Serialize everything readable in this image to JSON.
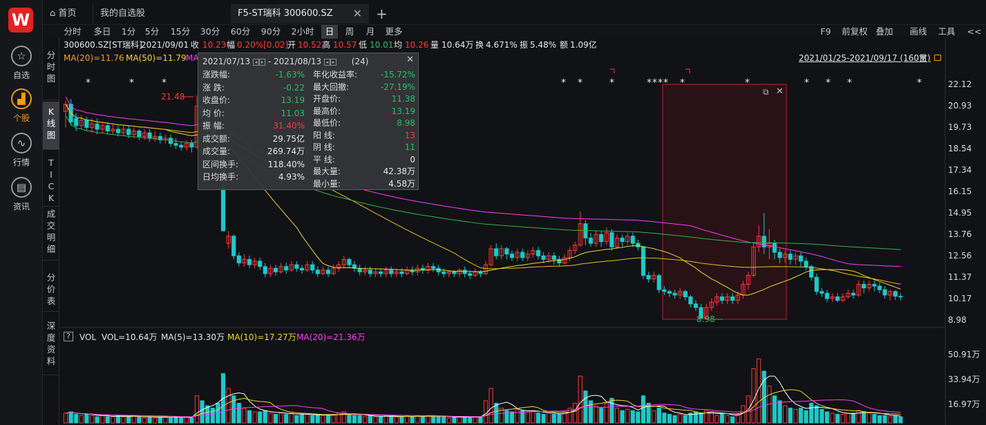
{
  "app": {
    "logo": "W"
  },
  "rail": [
    {
      "label": "自选",
      "icon": "☆",
      "icon_name": "star-icon",
      "active": false
    },
    {
      "label": "个股",
      "icon": "▟",
      "icon_name": "stock-chart-icon",
      "active": true
    },
    {
      "label": "行情",
      "icon": "∿",
      "icon_name": "market-icon",
      "active": false
    },
    {
      "label": "资讯",
      "icon": "▤",
      "icon_name": "news-icon",
      "active": false
    }
  ],
  "tabs": {
    "home": "首页",
    "home_icon": "⌂",
    "watchlist": "我的自选股",
    "current": "F5-ST瑞科 300600.SZ",
    "close": "✕",
    "add": "+"
  },
  "periods": [
    "分时",
    "多日",
    "1分",
    "5分",
    "15分",
    "30分",
    "60分",
    "90分",
    "2小时",
    "日",
    "周",
    "月",
    "更多"
  ],
  "period_selected": "日",
  "tools": [
    "F9",
    "前复权",
    "叠加",
    "画线",
    "工具",
    "<<"
  ],
  "vtabs": [
    {
      "label": "分时图",
      "selected": false
    },
    {
      "label": "K线图",
      "selected": true
    },
    {
      "label": "TICK",
      "selected": false
    },
    {
      "label": "成交明细",
      "selected": false
    },
    {
      "label": "分价表",
      "selected": false
    },
    {
      "label": "深度资料",
      "selected": false
    }
  ],
  "quote": {
    "code": "300600.SZ[ST瑞科]",
    "date": "2021/09/01",
    "close_label": "收",
    "close": "10.23",
    "change_label": "幅",
    "change": "0.20%[0.02]",
    "open_label": "开",
    "open": "10.52",
    "high_label": "高",
    "high": "10.57",
    "low_label": "低",
    "low": "10.01",
    "avg_label": "均",
    "avg": "10.26",
    "vol_label": "量",
    "vol": "10.64万",
    "turnover_label": "换",
    "turnover": "4.671%",
    "amp_label": "振",
    "amp": "5.48%",
    "amount_label": "额",
    "amount": "1.09亿"
  },
  "ma": {
    "ma20": "MA(20)=11.76",
    "ma50": "MA(50)=11.79",
    "ma_cut": "MA"
  },
  "range_label": "2021/01/25-2021/09/17 (160日)",
  "popup": {
    "from": "2021/07/13",
    "to": "- 2021/08/13",
    "count": "(24)",
    "close": "✕",
    "left": [
      {
        "k": "涨跌幅:",
        "v": "-1.63%",
        "c": "green"
      },
      {
        "k": "涨  跌:",
        "v": "-0.22",
        "c": "green"
      },
      {
        "k": "收盘价:",
        "v": "13.19",
        "c": "green"
      },
      {
        "k": "均  价:",
        "v": "11.03",
        "c": "green"
      },
      {
        "k": "振  幅:",
        "v": "31.40%",
        "c": "red"
      },
      {
        "k": "成交额:",
        "v": "29.75亿",
        "c": "white"
      },
      {
        "k": "成交量:",
        "v": "269.74万",
        "c": "white"
      },
      {
        "k": "区间换手:",
        "v": "118.40%",
        "c": "white"
      },
      {
        "k": "日均换手:",
        "v": "4.93%",
        "c": "white"
      }
    ],
    "right": [
      {
        "k": "年化收益率:",
        "v": "-15.72%",
        "c": "green"
      },
      {
        "k": "最大回撤:",
        "v": "-27.19%",
        "c": "green"
      },
      {
        "k": "开盘价:",
        "v": "11.38",
        "c": "green"
      },
      {
        "k": "最高价:",
        "v": "13.19",
        "c": "green"
      },
      {
        "k": "最低价:",
        "v": "8.98",
        "c": "green"
      },
      {
        "k": "阳  线:",
        "v": "13",
        "c": "red"
      },
      {
        "k": "阴  线:",
        "v": "11",
        "c": "green"
      },
      {
        "k": "平  线:",
        "v": "0",
        "c": "white"
      },
      {
        "k": "最大量:",
        "v": "42.38万",
        "c": "white"
      },
      {
        "k": "最小量:",
        "v": "4.58万",
        "c": "white"
      }
    ]
  },
  "annotations": {
    "high_mark": "21.48",
    "low_mark": "8.98",
    "star": "*"
  },
  "price_axis": [
    "22.12",
    "20.93",
    "19.73",
    "18.54",
    "17.34",
    "16.15",
    "14.95",
    "13.76",
    "12.56",
    "11.37",
    "10.17",
    "8.98"
  ],
  "vol_axis": [
    "50.91万",
    "33.94万",
    "16.97万"
  ],
  "vol_legend": {
    "help": "?",
    "name": "VOL",
    "vol": "VOL=10.64万",
    "ma5": "MA(5)=13.30万",
    "ma10": "MA(10)=17.27万",
    "ma20": "MA(20)=21.36万"
  },
  "colors": {
    "up": "#ff3a3a",
    "down": "#1ec8c8",
    "ma5": "#ffffff",
    "ma10": "#f3d63b",
    "ma20": "#ff3dff",
    "ma_long": "#2fb84a",
    "accent": "#f29a1c",
    "logo": "#e02323"
  },
  "chart_data": {
    "type": "candlestick",
    "xlabel": "",
    "ylabel": "",
    "ylim": [
      8.98,
      22.12
    ],
    "note": "candle values approximated from the picture",
    "candles": [
      [
        20.6,
        21.0,
        21.2,
        19.7
      ],
      [
        21.0,
        20.0,
        21.3,
        19.8
      ],
      [
        20.2,
        19.8,
        20.5,
        19.5
      ],
      [
        19.8,
        20.1,
        20.4,
        19.6
      ],
      [
        20.1,
        19.7,
        20.3,
        19.5
      ],
      [
        19.7,
        19.9,
        20.2,
        19.4
      ],
      [
        19.9,
        19.6,
        20.2,
        19.3
      ],
      [
        19.6,
        19.8,
        20.0,
        19.4
      ],
      [
        19.8,
        19.5,
        20.0,
        19.3
      ],
      [
        19.5,
        19.6,
        19.9,
        19.3
      ],
      [
        19.6,
        19.4,
        19.8,
        19.2
      ],
      [
        19.4,
        19.6,
        19.8,
        19.2
      ],
      [
        19.6,
        19.3,
        19.8,
        19.1
      ],
      [
        19.3,
        19.5,
        19.7,
        19.1
      ],
      [
        19.5,
        19.2,
        19.6,
        19.0
      ],
      [
        19.2,
        19.4,
        19.6,
        19.0
      ],
      [
        19.4,
        19.1,
        19.6,
        18.9
      ],
      [
        19.1,
        19.2,
        19.5,
        18.9
      ],
      [
        19.2,
        19.0,
        19.4,
        18.8
      ],
      [
        19.0,
        19.1,
        19.3,
        18.8
      ],
      [
        19.1,
        18.8,
        19.3,
        18.6
      ],
      [
        18.8,
        18.7,
        19.1,
        18.5
      ],
      [
        18.7,
        18.6,
        18.9,
        18.4
      ],
      [
        18.6,
        18.8,
        19.0,
        18.4
      ],
      [
        18.8,
        18.6,
        19.0,
        18.3
      ],
      [
        18.6,
        20.9,
        21.48,
        18.5
      ],
      [
        20.9,
        20.3,
        21.2,
        19.8
      ],
      [
        20.3,
        19.8,
        20.6,
        19.4
      ],
      [
        19.8,
        19.3,
        20.1,
        19.0
      ],
      [
        19.3,
        18.6,
        19.6,
        18.2
      ],
      [
        18.6,
        13.9,
        18.6,
        13.9
      ],
      [
        13.2,
        13.6,
        13.9,
        12.9
      ],
      [
        13.6,
        12.5,
        13.7,
        12.3
      ],
      [
        12.5,
        12.1,
        12.7,
        11.9
      ],
      [
        12.1,
        12.3,
        12.6,
        11.9
      ],
      [
        12.3,
        12.0,
        12.5,
        11.8
      ],
      [
        12.0,
        12.2,
        12.4,
        11.8
      ],
      [
        12.2,
        11.9,
        12.4,
        11.7
      ],
      [
        11.9,
        11.5,
        12.1,
        11.3
      ],
      [
        11.5,
        11.8,
        12.0,
        11.3
      ],
      [
        11.8,
        11.6,
        12.0,
        11.4
      ],
      [
        11.6,
        11.9,
        12.1,
        11.5
      ],
      [
        11.9,
        11.7,
        12.1,
        11.5
      ],
      [
        11.7,
        12.0,
        12.2,
        11.6
      ],
      [
        12.0,
        11.8,
        12.2,
        11.6
      ],
      [
        11.8,
        11.7,
        12.0,
        11.5
      ],
      [
        11.7,
        12.0,
        12.2,
        11.6
      ],
      [
        12.0,
        11.7,
        12.2,
        11.5
      ],
      [
        11.7,
        11.5,
        11.9,
        11.3
      ],
      [
        11.5,
        11.7,
        11.9,
        11.4
      ],
      [
        11.7,
        11.5,
        11.9,
        11.3
      ],
      [
        11.5,
        11.8,
        12.0,
        11.4
      ],
      [
        11.8,
        12.0,
        12.2,
        11.6
      ],
      [
        12.0,
        12.3,
        12.5,
        11.8
      ],
      [
        12.3,
        12.0,
        12.4,
        11.8
      ],
      [
        12.0,
        11.8,
        12.2,
        11.6
      ],
      [
        11.8,
        11.6,
        12.0,
        11.4
      ],
      [
        11.6,
        11.7,
        11.9,
        11.4
      ],
      [
        11.7,
        11.5,
        11.9,
        11.3
      ],
      [
        11.5,
        11.6,
        11.8,
        11.3
      ],
      [
        11.6,
        11.5,
        11.8,
        11.3
      ],
      [
        11.5,
        11.7,
        11.9,
        11.3
      ],
      [
        11.7,
        11.5,
        11.9,
        11.3
      ],
      [
        11.5,
        11.6,
        11.8,
        11.3
      ],
      [
        11.6,
        11.5,
        11.8,
        11.3
      ],
      [
        11.5,
        11.7,
        11.9,
        11.4
      ],
      [
        11.7,
        11.6,
        11.9,
        11.4
      ],
      [
        11.6,
        11.8,
        12.0,
        11.4
      ],
      [
        11.8,
        11.7,
        12.0,
        11.5
      ],
      [
        11.7,
        11.9,
        12.1,
        11.5
      ],
      [
        11.9,
        11.8,
        12.1,
        11.6
      ],
      [
        11.8,
        11.6,
        12.0,
        11.4
      ],
      [
        11.6,
        11.5,
        11.8,
        11.3
      ],
      [
        11.5,
        11.6,
        11.7,
        11.3
      ],
      [
        11.6,
        11.5,
        11.7,
        11.3
      ],
      [
        11.5,
        11.7,
        11.8,
        11.3
      ],
      [
        11.7,
        11.5,
        11.9,
        11.3
      ],
      [
        11.5,
        11.4,
        11.7,
        11.2
      ],
      [
        11.4,
        11.6,
        11.8,
        11.3
      ],
      [
        11.6,
        11.5,
        11.7,
        11.3
      ],
      [
        11.5,
        12.0,
        12.2,
        11.4
      ],
      [
        12.0,
        12.9,
        13.1,
        11.9
      ],
      [
        12.9,
        12.5,
        13.2,
        12.3
      ],
      [
        12.5,
        12.9,
        13.1,
        12.3
      ],
      [
        12.9,
        12.6,
        13.0,
        12.3
      ],
      [
        12.6,
        12.4,
        12.8,
        12.2
      ],
      [
        12.4,
        12.7,
        12.9,
        12.2
      ],
      [
        12.7,
        12.4,
        12.9,
        12.2
      ],
      [
        12.4,
        12.6,
        12.8,
        12.2
      ],
      [
        12.6,
        12.8,
        13.0,
        12.4
      ],
      [
        12.8,
        12.5,
        13.0,
        12.3
      ],
      [
        12.5,
        12.3,
        12.7,
        12.1
      ],
      [
        12.3,
        12.5,
        12.7,
        12.1
      ],
      [
        12.5,
        12.3,
        12.7,
        12.0
      ],
      [
        12.3,
        12.1,
        12.5,
        11.9
      ],
      [
        12.1,
        12.4,
        12.6,
        12.0
      ],
      [
        12.4,
        12.8,
        13.0,
        12.2
      ],
      [
        12.8,
        13.1,
        13.3,
        12.6
      ],
      [
        13.1,
        14.3,
        15.0,
        13.0
      ],
      [
        14.3,
        13.5,
        14.5,
        13.1
      ],
      [
        13.5,
        13.2,
        13.8,
        13.0
      ],
      [
        13.2,
        13.7,
        13.9,
        13.0
      ],
      [
        13.7,
        13.3,
        13.9,
        13.0
      ],
      [
        13.3,
        13.8,
        14.1,
        13.1
      ],
      [
        13.8,
        13.0,
        14.0,
        12.8
      ],
      [
        13.0,
        13.5,
        13.7,
        12.9
      ],
      [
        13.5,
        13.3,
        13.7,
        13.0
      ],
      [
        13.3,
        13.6,
        13.8,
        13.1
      ],
      [
        13.6,
        13.2,
        13.8,
        13.0
      ],
      [
        13.2,
        13.0,
        13.4,
        12.8
      ],
      [
        13.0,
        11.4,
        13.0,
        11.2
      ],
      [
        11.4,
        11.2,
        11.6,
        11.0
      ],
      [
        11.2,
        11.4,
        11.6,
        11.0
      ],
      [
        11.4,
        10.6,
        11.5,
        10.4
      ],
      [
        10.6,
        10.5,
        10.8,
        10.3
      ],
      [
        10.5,
        10.4,
        10.6,
        10.2
      ],
      [
        10.4,
        10.3,
        10.6,
        10.1
      ],
      [
        10.3,
        10.5,
        10.7,
        10.1
      ],
      [
        10.5,
        10.2,
        10.6,
        10.0
      ],
      [
        10.2,
        9.8,
        10.3,
        9.6
      ],
      [
        9.8,
        9.6,
        10.0,
        9.4
      ],
      [
        9.6,
        9.0,
        9.8,
        8.98
      ],
      [
        9.0,
        9.6,
        9.8,
        8.98
      ],
      [
        9.6,
        9.9,
        10.1,
        9.4
      ],
      [
        9.9,
        10.2,
        10.4,
        9.7
      ],
      [
        10.2,
        10.0,
        10.4,
        9.8
      ],
      [
        10.0,
        10.2,
        10.4,
        9.8
      ],
      [
        10.2,
        10.0,
        10.4,
        9.8
      ],
      [
        10.0,
        10.3,
        10.5,
        9.8
      ],
      [
        10.3,
        10.9,
        11.1,
        10.1
      ],
      [
        10.9,
        11.4,
        11.6,
        10.6
      ],
      [
        11.4,
        13.0,
        13.2,
        11.3
      ],
      [
        13.0,
        13.6,
        14.2,
        12.7
      ],
      [
        13.6,
        13.0,
        14.9,
        12.6
      ],
      [
        13.0,
        13.2,
        14.0,
        12.3
      ],
      [
        13.2,
        12.7,
        13.4,
        12.3
      ],
      [
        12.7,
        12.4,
        12.9,
        12.1
      ],
      [
        12.4,
        12.6,
        12.8,
        12.1
      ],
      [
        12.6,
        12.3,
        12.8,
        12.0
      ],
      [
        12.3,
        12.5,
        12.7,
        12.0
      ],
      [
        12.5,
        12.2,
        12.7,
        11.9
      ],
      [
        12.2,
        11.9,
        12.4,
        11.7
      ],
      [
        11.9,
        11.3,
        12.0,
        11.1
      ],
      [
        11.3,
        10.5,
        11.5,
        10.3
      ],
      [
        10.5,
        10.4,
        10.7,
        10.2
      ],
      [
        10.4,
        10.1,
        10.6,
        9.9
      ],
      [
        10.1,
        10.2,
        10.4,
        9.9
      ],
      [
        10.2,
        10.0,
        10.4,
        9.9
      ],
      [
        10.0,
        10.2,
        10.4,
        9.9
      ],
      [
        10.2,
        10.4,
        10.6,
        10.1
      ],
      [
        10.4,
        10.3,
        10.6,
        10.1
      ],
      [
        10.3,
        10.9,
        11.1,
        10.2
      ],
      [
        10.9,
        10.7,
        11.1,
        10.4
      ],
      [
        10.7,
        10.9,
        11.1,
        10.5
      ],
      [
        10.9,
        10.8,
        11.1,
        10.5
      ],
      [
        10.8,
        10.6,
        11.0,
        10.4
      ],
      [
        10.6,
        10.3,
        10.8,
        10.1
      ],
      [
        10.3,
        10.5,
        10.6,
        10.0
      ],
      [
        10.5,
        10.23,
        10.57,
        10.01
      ],
      [
        10.23,
        10.2,
        10.4,
        10.0
      ]
    ],
    "volume_axis_max": 60,
    "volume": [
      8,
      9,
      7,
      6,
      7,
      6,
      5,
      6,
      5,
      5,
      6,
      5,
      5,
      6,
      5,
      4,
      5,
      4,
      5,
      5,
      4,
      5,
      4,
      5,
      4,
      22,
      18,
      14,
      12,
      16,
      40,
      28,
      22,
      16,
      12,
      10,
      9,
      9,
      10,
      8,
      7,
      8,
      7,
      8,
      6,
      7,
      7,
      6,
      7,
      6,
      6,
      7,
      8,
      9,
      7,
      6,
      6,
      5,
      6,
      5,
      5,
      6,
      5,
      5,
      5,
      6,
      5,
      6,
      5,
      6,
      6,
      5,
      5,
      4,
      5,
      5,
      5,
      4,
      5,
      5,
      18,
      28,
      16,
      12,
      10,
      9,
      11,
      10,
      9,
      10,
      8,
      7,
      8,
      7,
      7,
      9,
      12,
      16,
      38,
      26,
      18,
      14,
      12,
      16,
      20,
      12,
      10,
      11,
      10,
      9,
      22,
      16,
      10,
      12,
      8,
      7,
      6,
      7,
      6,
      8,
      9,
      8,
      10,
      9,
      6,
      7,
      6,
      5,
      7,
      14,
      22,
      44,
      52,
      42,
      30,
      22,
      18,
      14,
      12,
      11,
      12,
      10,
      16,
      14,
      11,
      9,
      8,
      7,
      7,
      8,
      8,
      10,
      9,
      8,
      7,
      6,
      6,
      5,
      6,
      5
    ]
  }
}
